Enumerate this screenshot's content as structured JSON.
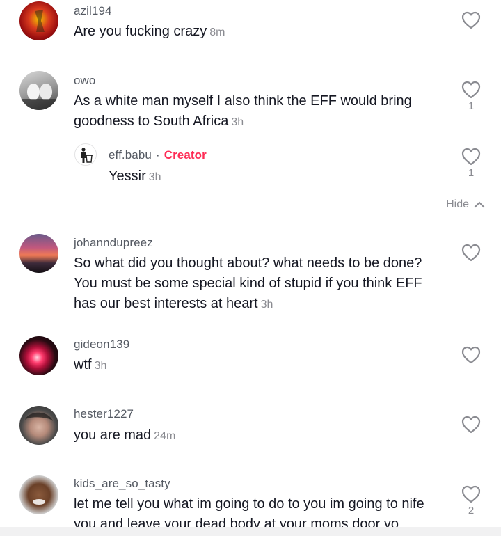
{
  "comments": [
    {
      "username": "azil194",
      "text": "Are you fucking crazy",
      "time": "8m",
      "likes": ""
    },
    {
      "username": "owo",
      "text": "As a white man myself I also think the EFF would bring goodness to South Africa",
      "time": "3h",
      "likes": "1",
      "reply": {
        "username": "eff.babu",
        "separator": "·",
        "badge": "Creator",
        "text": "Yessir",
        "time": "3h",
        "likes": "1"
      }
    },
    {
      "username": "johanndupreez",
      "text": "So what did you thought about? what needs to be done? You must be some special kind of stupid if you think EFF has our best interests at heart",
      "time": "3h",
      "likes": ""
    },
    {
      "username": "gideon139",
      "text": "wtf",
      "time": "3h",
      "likes": ""
    },
    {
      "username": "hester1227",
      "text": "you are mad",
      "time": "24m",
      "likes": ""
    },
    {
      "username": "kids_are_so_tasty",
      "text": "let me tell you what im going to do to you im going to nife you and leave your dead body at your moms door yo",
      "time": "",
      "likes": "2"
    }
  ],
  "hide_label": "Hide",
  "colors": {
    "accent": "#fe2c55",
    "secondary_text": "#8a8b91"
  }
}
